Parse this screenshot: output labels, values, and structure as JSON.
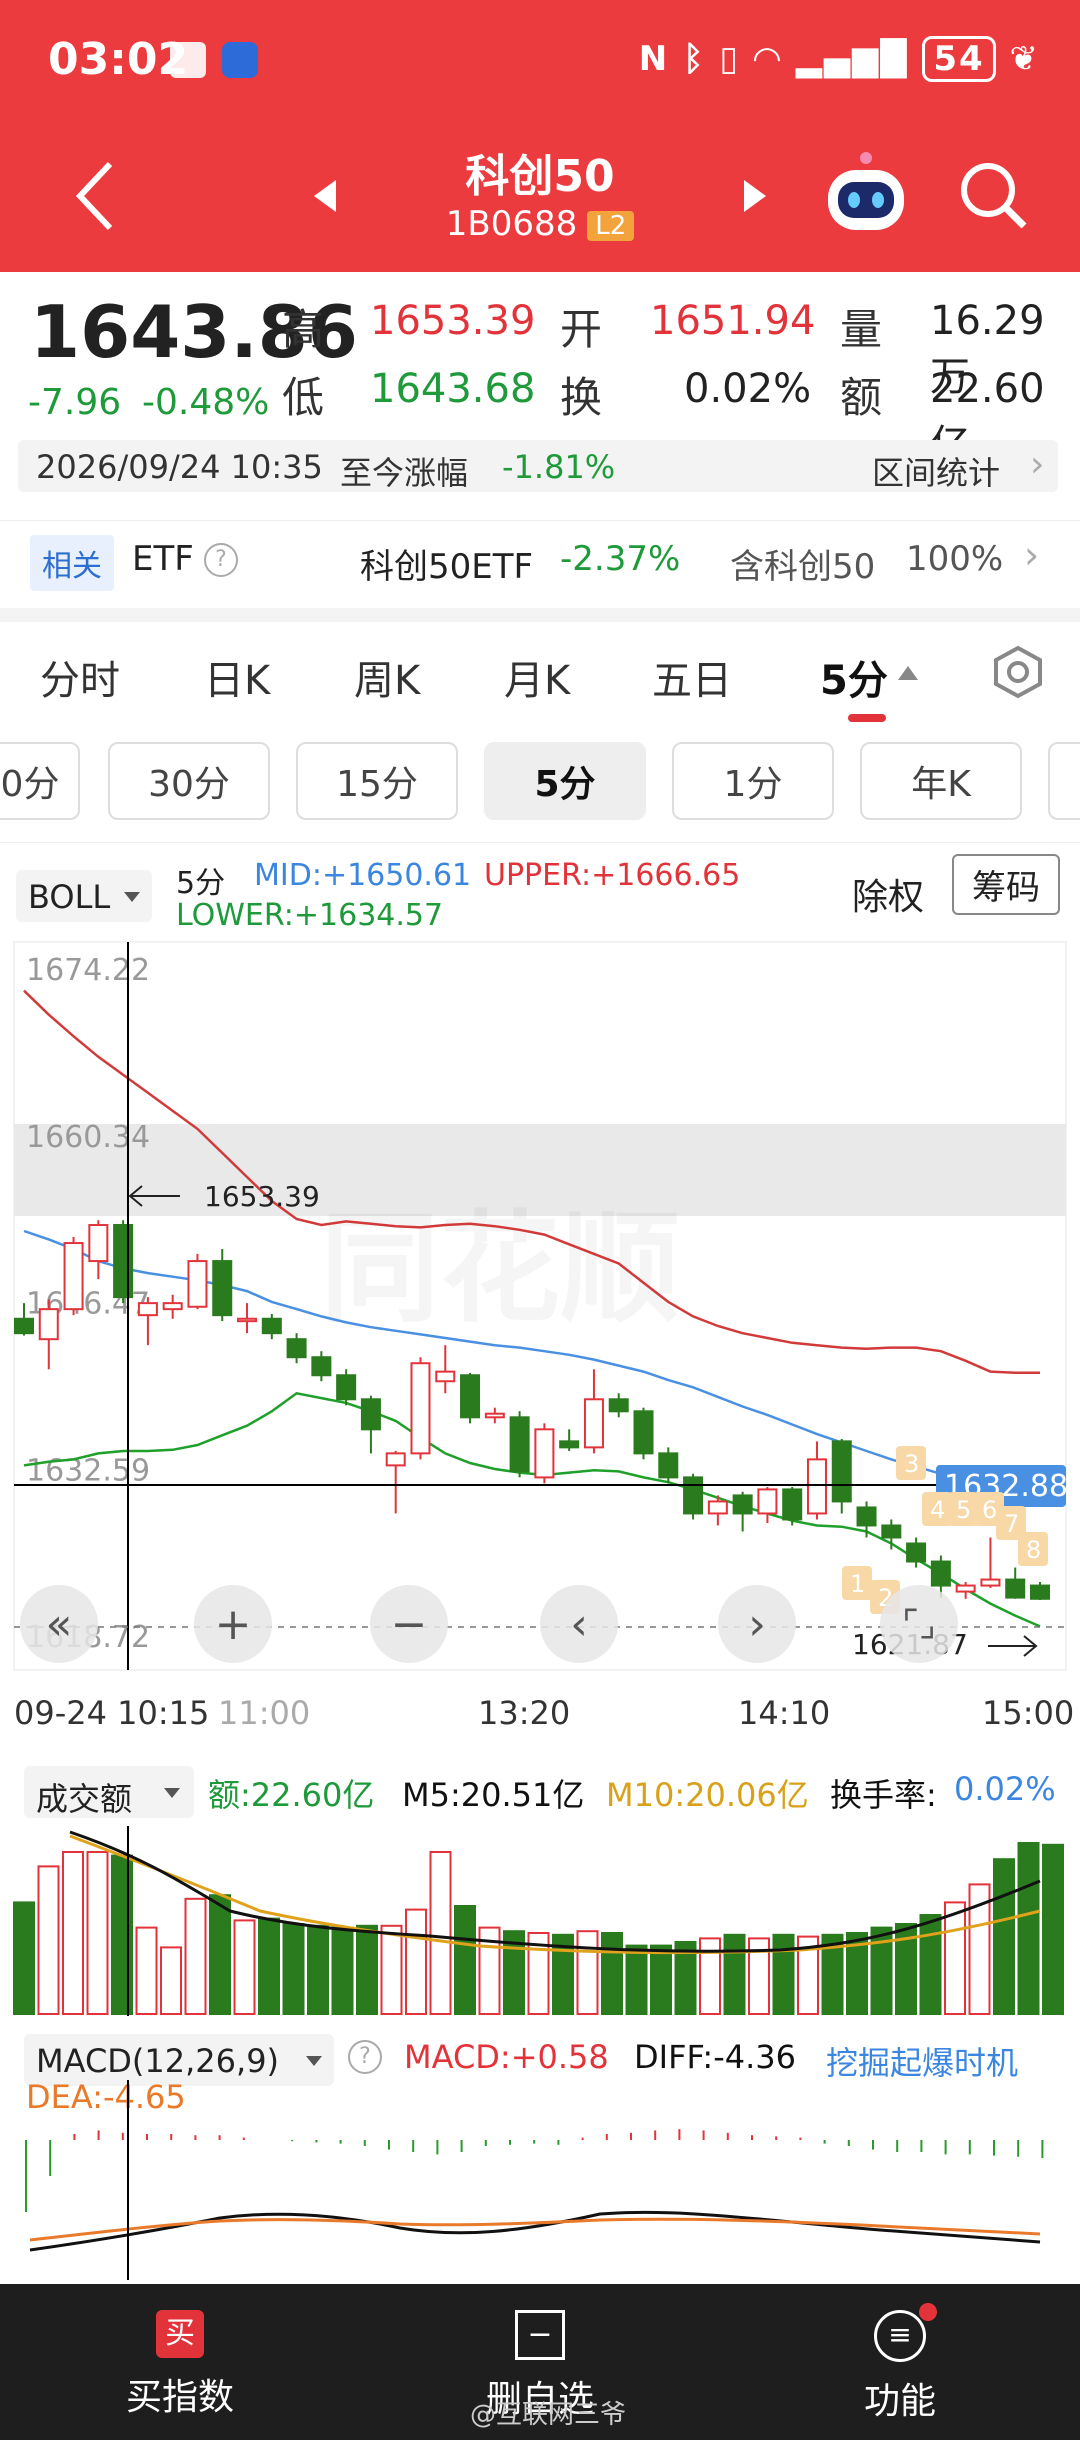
{
  "status_bar": {
    "time": "03:02",
    "battery": "54"
  },
  "header": {
    "title": "科创50",
    "code": "1B0688",
    "badge": "L2"
  },
  "quote": {
    "price": "1643.86",
    "change": "-7.96",
    "change_pct": "-0.48%",
    "high_label": "高",
    "high": "1653.39",
    "open_label": "开",
    "open": "1651.94",
    "vol_label": "量",
    "vol": "16.29万",
    "low_label": "低",
    "low": "1643.68",
    "turn_label": "换",
    "turn": "0.02%",
    "amt_label": "额",
    "amt": "22.60亿",
    "date_line": "2026/09/24 10:35",
    "since_label": "至今涨幅",
    "since_value": "-1.81%",
    "range_stat": "区间统计"
  },
  "etf": {
    "tag": "相关",
    "label": "ETF",
    "name": "科创50ETF",
    "change": "-2.37%",
    "contain": "含科创50",
    "contain_pct": "100%"
  },
  "tabs": [
    "分时",
    "日K",
    "周K",
    "月K",
    "五日",
    "5分"
  ],
  "pills": [
    "0分",
    "30分",
    "15分",
    "5分",
    "1分",
    "年K"
  ],
  "boll": {
    "selector": "BOLL",
    "period": "5分",
    "mid": "MID:+1650.61",
    "upper": "UPPER:+1666.65",
    "lower": "LOWER:+1634.57",
    "fq": "除权",
    "chips": "筹码"
  },
  "chart_axis": {
    "y_ticks": [
      "1674.22",
      "1660.34",
      "1646.47",
      "1632.59",
      "1618.72"
    ],
    "x_ticks": [
      "09-24 10:15",
      "11:00",
      "13:20",
      "14:10",
      "15:00"
    ],
    "high_marker": "1653.39",
    "low_marker": "1621.87",
    "cross_value": "1632.88",
    "event_badges": [
      "3",
      "4",
      "5",
      "6",
      "7",
      "8",
      "1",
      "2"
    ]
  },
  "volume_panel": {
    "selector": "成交额",
    "amount": "额:22.60亿",
    "m5": "M5:20.51亿",
    "m10": "M10:20.06亿",
    "turnover_label": "换手率:",
    "turnover": "0.02%"
  },
  "macd_panel": {
    "selector": "MACD(12,26,9)",
    "macd": "MACD:+0.58",
    "diff": "DIFF:-4.36",
    "dea": "DEA:-4.65",
    "link": "挖掘起爆时机"
  },
  "bottom_nav": {
    "buy": "买指数",
    "delete": "删自选",
    "func": "功能",
    "watermark": "@互联网三爷"
  },
  "chart_data": {
    "type": "candlestick",
    "ylim": [
      1618.72,
      1674.22
    ],
    "candles": [
      [
        1645.2,
        1644.0,
        1646.5,
        1643.8
      ],
      [
        1643.5,
        1646.0,
        1646.8,
        1641.0
      ],
      [
        1646.0,
        1651.5,
        1652.0,
        1645.5
      ],
      [
        1650.0,
        1653.0,
        1653.4,
        1648.5
      ],
      [
        1653.0,
        1647.0,
        1653.4,
        1646.5
      ],
      [
        1645.5,
        1646.5,
        1647.0,
        1643.0
      ],
      [
        1646.0,
        1646.5,
        1647.2,
        1645.2
      ],
      [
        1646.2,
        1650.0,
        1650.6,
        1646.0
      ],
      [
        1650.0,
        1645.5,
        1651.0,
        1645.0
      ],
      [
        1645.0,
        1645.2,
        1646.5,
        1644.0
      ],
      [
        1645.2,
        1644.0,
        1645.6,
        1643.5
      ],
      [
        1643.5,
        1642.0,
        1644.0,
        1641.5
      ],
      [
        1642.0,
        1640.5,
        1642.5,
        1640.0
      ],
      [
        1640.5,
        1638.5,
        1641.0,
        1638.0
      ],
      [
        1638.5,
        1636.0,
        1638.8,
        1634.0
      ],
      [
        1633.0,
        1634.0,
        1634.2,
        1629.0
      ],
      [
        1634.0,
        1641.5,
        1642.0,
        1633.5
      ],
      [
        1640.0,
        1640.8,
        1643.0,
        1639.0
      ],
      [
        1640.5,
        1637.0,
        1640.7,
        1636.5
      ],
      [
        1637.0,
        1637.3,
        1637.8,
        1636.5
      ],
      [
        1637.0,
        1632.5,
        1637.5,
        1632.0
      ],
      [
        1632.0,
        1636.0,
        1636.5,
        1631.5
      ],
      [
        1635.0,
        1634.5,
        1636.0,
        1634.2
      ],
      [
        1634.5,
        1638.5,
        1641.0,
        1634.0
      ],
      [
        1638.5,
        1637.5,
        1639.0,
        1637.0
      ],
      [
        1637.5,
        1634.0,
        1637.8,
        1633.5
      ],
      [
        1634.0,
        1632.0,
        1634.5,
        1631.5
      ],
      [
        1632.0,
        1629.0,
        1632.3,
        1628.5
      ],
      [
        1629.0,
        1630.0,
        1630.5,
        1628.0
      ],
      [
        1630.5,
        1629.0,
        1630.8,
        1627.5
      ],
      [
        1629.0,
        1631.0,
        1631.2,
        1628.2
      ],
      [
        1631.0,
        1628.5,
        1631.2,
        1628.0
      ],
      [
        1629.0,
        1633.5,
        1635.0,
        1628.5
      ],
      [
        1635.0,
        1630.0,
        1635.2,
        1629.0
      ],
      [
        1629.5,
        1628.0,
        1630.0,
        1627.0
      ],
      [
        1628.0,
        1627.0,
        1628.5,
        1626.0
      ],
      [
        1626.5,
        1625.0,
        1627.0,
        1624.5
      ],
      [
        1625.0,
        1623.0,
        1625.5,
        1622.0
      ],
      [
        1622.5,
        1623.0,
        1623.3,
        1621.9
      ],
      [
        1623.0,
        1623.5,
        1627.0,
        1622.8
      ],
      [
        1623.5,
        1622.0,
        1624.5,
        1621.9
      ],
      [
        1623.0,
        1621.9,
        1623.3,
        1621.8
      ]
    ],
    "upper": [
      1672.5,
      1670.5,
      1668.7,
      1667.0,
      1665.5,
      1664.0,
      1662.5,
      1661.0,
      1659.0,
      1657.0,
      1655.0,
      1653.5,
      1653.0,
      1653.3,
      1653.1,
      1652.9,
      1652.8,
      1653.0,
      1653.1,
      1652.9,
      1652.6,
      1652.2,
      1651.4,
      1650.6,
      1649.8,
      1648.2,
      1646.6,
      1645.4,
      1644.6,
      1644.0,
      1643.6,
      1643.2,
      1643.0,
      1642.8,
      1642.7,
      1642.8,
      1642.8,
      1642.5,
      1641.7,
      1640.8,
      1640.7,
      1640.7
    ],
    "mid": [
      1652.5,
      1651.8,
      1651.0,
      1650.0,
      1649.4,
      1649.0,
      1648.7,
      1648.4,
      1648.0,
      1647.5,
      1646.6,
      1646.0,
      1645.4,
      1644.9,
      1644.5,
      1644.2,
      1643.9,
      1643.6,
      1643.3,
      1643.0,
      1642.8,
      1642.5,
      1642.2,
      1641.8,
      1641.3,
      1640.8,
      1640.1,
      1639.5,
      1638.7,
      1637.9,
      1637.2,
      1636.4,
      1635.6,
      1634.9,
      1634.2,
      1633.5,
      1632.9,
      1632.3,
      1631.7,
      1631.1,
      1630.6,
      1630.2
    ],
    "lower": [
      1633.0,
      1633.3,
      1633.5,
      1634.0,
      1634.2,
      1634.2,
      1634.3,
      1634.7,
      1635.5,
      1636.3,
      1637.5,
      1639.0,
      1638.6,
      1638.2,
      1637.5,
      1636.7,
      1635.3,
      1634.0,
      1633.2,
      1632.7,
      1632.4,
      1632.2,
      1632.4,
      1632.6,
      1632.5,
      1632.0,
      1631.6,
      1631.0,
      1630.3,
      1629.6,
      1629.0,
      1628.4,
      1628.0,
      1627.9,
      1627.5,
      1626.5,
      1625.2,
      1624.0,
      1622.7,
      1621.5,
      1620.5,
      1619.6
    ],
    "volume": [
      0.62,
      0.82,
      0.9,
      0.9,
      0.88,
      0.48,
      0.37,
      0.64,
      0.66,
      0.52,
      0.53,
      0.5,
      0.49,
      0.48,
      0.49,
      0.49,
      0.58,
      0.9,
      0.6,
      0.48,
      0.46,
      0.45,
      0.44,
      0.46,
      0.45,
      0.38,
      0.38,
      0.4,
      0.42,
      0.44,
      0.42,
      0.44,
      0.43,
      0.44,
      0.45,
      0.48,
      0.5,
      0.55,
      0.62,
      0.72,
      0.86,
      0.95,
      0.94
    ],
    "macd_hist": [
      -0.6,
      -0.3,
      0.05,
      0.08,
      0.06,
      0.05,
      0.05,
      0.04,
      0.04,
      0.02,
      0.0,
      -0.01,
      -0.02,
      -0.03,
      -0.05,
      -0.08,
      -0.1,
      -0.12,
      -0.1,
      -0.05,
      -0.04,
      -0.03,
      -0.04,
      0.02,
      0.05,
      0.06,
      0.08,
      0.09,
      0.08,
      0.06,
      0.04,
      0.03,
      0.02,
      -0.03,
      -0.05,
      -0.08,
      -0.1,
      -0.1,
      -0.12,
      -0.12,
      -0.13,
      -0.14,
      -0.15
    ]
  }
}
